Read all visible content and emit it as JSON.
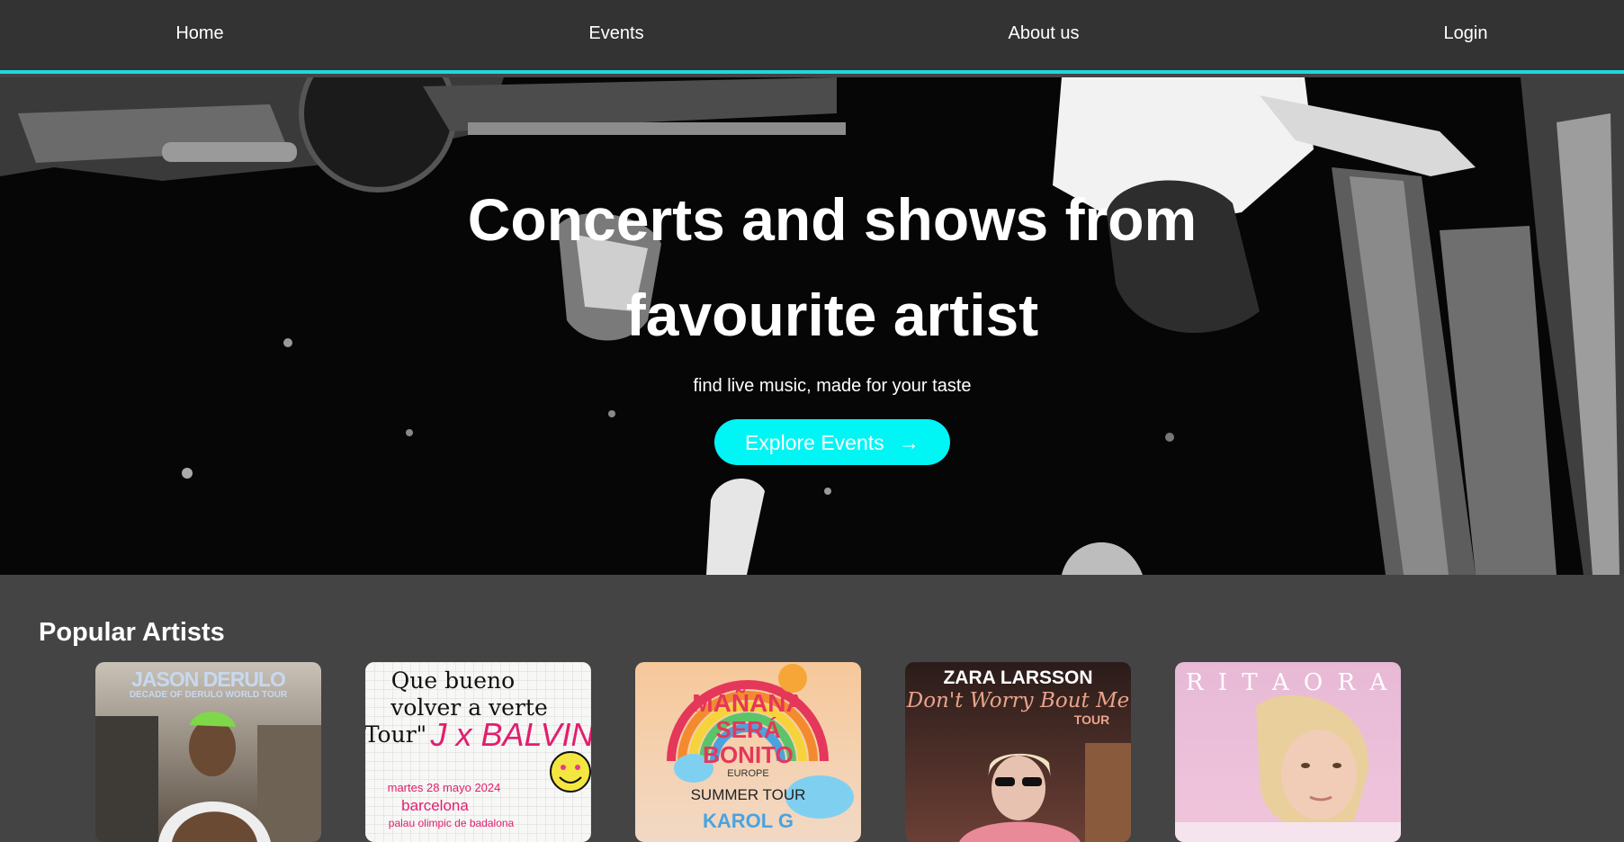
{
  "nav": {
    "home": "Home",
    "events": "Events",
    "about": "About us",
    "login": "Login"
  },
  "hero": {
    "title": "Concerts and shows from favourite artist",
    "subtitle": "find live music, made for your taste",
    "cta_label": "Explore Events",
    "cta_icon": "→"
  },
  "popular": {
    "heading": "Popular Artists",
    "cards": [
      {
        "line1": "JASON DERULO",
        "line2": "DECADE OF DERULO WORLD TOUR"
      },
      {
        "line1": "Que bueno",
        "line2": "volver a verte",
        "line3": "Tour\"",
        "line4": "J x BALVIN",
        "line5": "martes 28 mayo 2024",
        "line6": "barcelona",
        "line7": "palau olimpic de badalona"
      },
      {
        "line1": "MAÑANA",
        "line2": "SERÁ",
        "line3": "BONITO",
        "line4": "EUROPE",
        "line5": "SUMMER TOUR",
        "line6": "KAROL G"
      },
      {
        "line1": "ZARA LARSSON",
        "line2": "Don't Worry Bout Me",
        "line3": "TOUR"
      },
      {
        "line1": "R I T A  O R A"
      }
    ]
  },
  "colors": {
    "nav_bg": "#333333",
    "accent": "#20d6e0",
    "cta_bg": "#00f5f5",
    "page_bg": "#444444"
  }
}
